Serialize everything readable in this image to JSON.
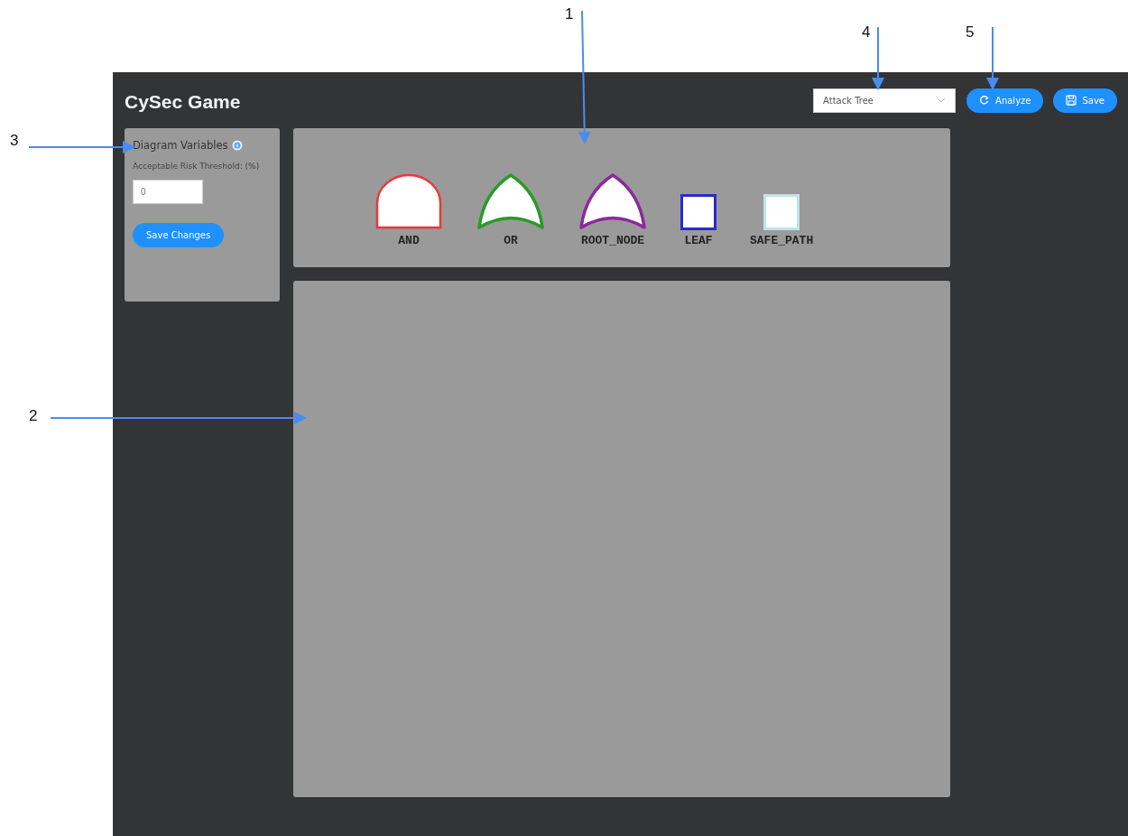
{
  "annotations": [
    {
      "label": "1"
    },
    {
      "label": "2"
    },
    {
      "label": "3"
    },
    {
      "label": "4"
    },
    {
      "label": "5"
    }
  ],
  "app": {
    "title": "CySec Game",
    "header": {
      "diagram_type": {
        "value": "Attack Tree"
      },
      "buttons": [
        {
          "label": "Analyze",
          "kind": "refresh"
        },
        {
          "label": "Save",
          "kind": "save"
        }
      ]
    },
    "variables_panel": {
      "title": "Diagram Variables",
      "field_label": "Acceptable Risk Threshold: (%)",
      "field_value": "0",
      "button": "Save Changes"
    },
    "palette": [
      {
        "kind": "and",
        "label": "AND",
        "color": "#e83a3a"
      },
      {
        "kind": "or",
        "label": "OR",
        "color": "#2a9a2a"
      },
      {
        "kind": "root",
        "label": "ROOT_NODE",
        "color": "#8a2a9a"
      },
      {
        "kind": "leaf",
        "label": "LEAF",
        "color": "#2a2ad0"
      },
      {
        "kind": "safe",
        "label": "SAFE_PATH",
        "color": "#bfe3ea"
      }
    ]
  }
}
